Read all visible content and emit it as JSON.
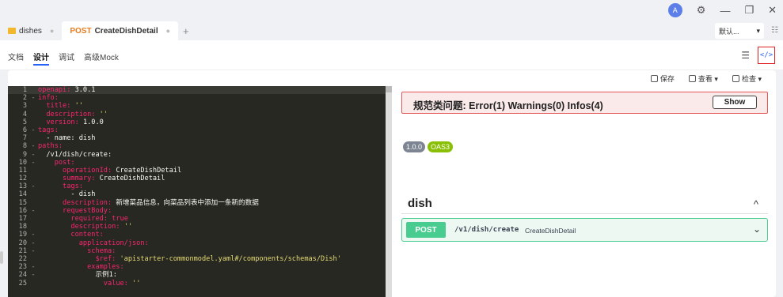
{
  "window": {
    "avatar_letter": "A",
    "settings_icon": "⚙",
    "minimize": "—",
    "restore": "❐",
    "close": "✕"
  },
  "tabs": [
    {
      "label": "dishes",
      "icon": "folder-icon"
    },
    {
      "method": "POST",
      "label": "CreateDishDetail"
    }
  ],
  "env": {
    "label": "默认...",
    "arrow": "▾",
    "icon": "☷"
  },
  "subtabs": [
    "文档",
    "设计",
    "调试",
    "高级Mock"
  ],
  "toolbar": {
    "save": "保存",
    "view": "查看",
    "check": "检查",
    "menu_icon": "☰",
    "code_icon": "</>"
  },
  "editor": {
    "lines": [
      {
        "n": "1",
        "f": "",
        "k": "openapi",
        "v": " 3.0.1",
        "indent": ""
      },
      {
        "n": "2",
        "f": "-",
        "k": "info",
        "v": "",
        "indent": ""
      },
      {
        "n": "3",
        "f": "",
        "k": "title",
        "v": " ''",
        "indent": "  "
      },
      {
        "n": "4",
        "f": "",
        "k": "description",
        "v": " ''",
        "indent": "  "
      },
      {
        "n": "5",
        "f": "",
        "k": "version",
        "v": " 1.0.0",
        "indent": "  "
      },
      {
        "n": "6",
        "f": "-",
        "k": "tags",
        "v": "",
        "indent": ""
      },
      {
        "n": "7",
        "f": "",
        "k": "",
        "v": "- name: dish",
        "indent": "  "
      },
      {
        "n": "8",
        "f": "-",
        "k": "paths",
        "v": "",
        "indent": ""
      },
      {
        "n": "9",
        "f": "-",
        "k": "",
        "v": "/v1/dish/create:",
        "indent": "  "
      },
      {
        "n": "10",
        "f": "-",
        "k": "post",
        "v": "",
        "indent": "    "
      },
      {
        "n": "11",
        "f": "",
        "k": "operationId",
        "v": " CreateDishDetail",
        "indent": "      "
      },
      {
        "n": "12",
        "f": "",
        "k": "summary",
        "v": " CreateDishDetail",
        "indent": "      "
      },
      {
        "n": "13",
        "f": "-",
        "k": "tags",
        "v": "",
        "indent": "      "
      },
      {
        "n": "14",
        "f": "",
        "k": "",
        "v": "- dish",
        "indent": "        "
      },
      {
        "n": "15",
        "f": "",
        "k": "description",
        "v": " 新增菜品信息，向菜品列表中添加一条新的数据",
        "indent": "      "
      },
      {
        "n": "16",
        "f": "-",
        "k": "requestBody",
        "v": "",
        "indent": "      "
      },
      {
        "n": "17",
        "f": "",
        "k": "required",
        "v": " true",
        "indent": "        "
      },
      {
        "n": "18",
        "f": "",
        "k": "description",
        "v": " ''",
        "indent": "        "
      },
      {
        "n": "19",
        "f": "-",
        "k": "content",
        "v": "",
        "indent": "        "
      },
      {
        "n": "20",
        "f": "-",
        "k": "application/json",
        "v": "",
        "indent": "          "
      },
      {
        "n": "21",
        "f": "-",
        "k": "schema",
        "v": "",
        "indent": "            "
      },
      {
        "n": "22",
        "f": "",
        "k": "$ref",
        "v": " 'apistarter-commonmodel.yaml#/components/schemas/Dish'",
        "indent": "              "
      },
      {
        "n": "23",
        "f": "-",
        "k": "examples",
        "v": "",
        "indent": "            "
      },
      {
        "n": "24",
        "f": "-",
        "k": "",
        "v": "示例1:",
        "indent": "              "
      },
      {
        "n": "25",
        "f": "",
        "k": "value",
        "v": " ''",
        "indent": "                "
      }
    ]
  },
  "problems": {
    "text": "规范类问题: Error(1) Warnings(0) Infos(4)",
    "button": "Show"
  },
  "badges": {
    "version": "1.0.0",
    "spec": "OAS3"
  },
  "tag": {
    "name": "dish",
    "chevron": "^"
  },
  "operation": {
    "method": "POST",
    "path": "/v1/dish/create",
    "summary": "CreateDishDetail",
    "chevron": "⌄"
  }
}
